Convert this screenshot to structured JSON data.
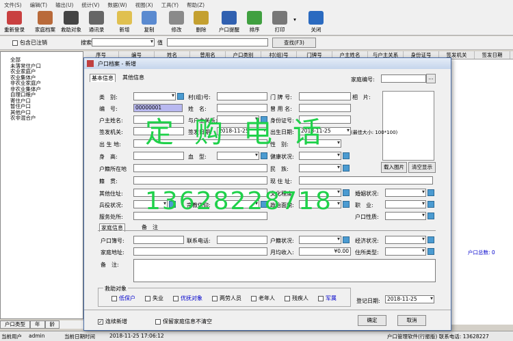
{
  "menu": [
    "文件(S)",
    "编辑(T)",
    "输出(U)",
    "统计(V)",
    "数据(W)",
    "视图(X)",
    "工具(Y)",
    "帮助(Z)"
  ],
  "toolbar": [
    "重新登录",
    "家庭档案",
    "救助对象",
    "通讯录",
    "新增",
    "复制",
    "修改",
    "删除",
    "户口提醒",
    "排序",
    "打印",
    "关闭"
  ],
  "filter": {
    "include_cancelled": "包含已注销",
    "search_label": "搜索",
    "value_label": "值",
    "find_button": "查找(F3)"
  },
  "tree": [
    "全部",
    "未落常住户口",
    "农业家庭户",
    "农业集体户",
    "非农业家庭户",
    "非农业集体户",
    "自理口粮户",
    "寄住户口",
    "暂住户口",
    "其他户口",
    "农非混合户"
  ],
  "grid_columns": [
    "序号",
    "户口类别",
    "村(组)号",
    "门牌号",
    "户主姓名",
    "与户主关系",
    "身份证号",
    "签发机关",
    "签发日期"
  ],
  "grid_columns_top": [
    "序号",
    "编号",
    "姓名",
    "曾用名",
    "户口类别",
    "村(组)号",
    "门牌号",
    "户主姓名",
    "与户主关系",
    "身份证号",
    "签发机关",
    "签发日期"
  ],
  "grid_total_label": "户口总数: 0",
  "bottom_tabs": [
    "户口类型",
    "年",
    "龄"
  ],
  "status": {
    "user_label": "当前用户",
    "user": "admin",
    "date_label": "当前日期时间",
    "datetime": "2018-11-25 17:06:12",
    "right": "户口管理软件(行振版) 联系电话: 13628227"
  },
  "dialog": {
    "title": "户口档案 - 新增",
    "tabs": [
      "基本信息",
      "其他信息"
    ],
    "family_no_label": "家庭编号:",
    "labels": {
      "category": "类　别:",
      "village": "村(组)号:",
      "door": "门 牌 号:",
      "photo": "相　片:",
      "serial": "编　号:",
      "name": "姓　名:",
      "former_name": "曾 用 名:",
      "householder": "户主姓名:",
      "relation": "与户主关系:",
      "id_no": "身份证号:",
      "issuer": "签发机关:",
      "issue_date": "签发日期:",
      "birth_date": "出生日期:",
      "birthplace": "出 生 地:",
      "gender": "性　别:",
      "height": "身　高:",
      "blood": "血　型:",
      "health": "健康状况:",
      "registry": "户籍所在地",
      "ethnic": "民　族:",
      "native": "籍　贯:",
      "current_addr": "现 住 址:",
      "other_addr": "其他住址:",
      "education": "文化程度:",
      "marriage": "婚姻状况:",
      "military": "兵役状况:",
      "religion": "宗教信仰:",
      "politics": "政治面貌:",
      "job": "职　业:",
      "workplace": "服务处所:",
      "hukou_nature": "户口性质:"
    },
    "serial_value": "00000001",
    "issue_date_value": "2018-11-25",
    "birth_date_value": "2018-11-25",
    "photo_size_note": "(最佳大小: 100*100)",
    "photo_load": "载入图片",
    "photo_clear": "清空显示",
    "sub_tabs": [
      "家庭信息",
      "备　注"
    ],
    "family": {
      "book_no": "户口簿号:",
      "phone": "联系电话:",
      "hukou_status": "户籍状况:",
      "economy": "经济状况:",
      "address": "家庭地址:",
      "income": "月均收入:",
      "income_value": "¥0.00",
      "housing": "住所类型:",
      "remark": "备　注:"
    },
    "aid": {
      "label": "救助对象",
      "items": [
        {
          "text": "低保户",
          "color": "#0000cc"
        },
        {
          "text": "失业",
          "color": "#000000"
        },
        {
          "text": "优抚对象",
          "color": "#0000cc"
        },
        {
          "text": "两劳人员",
          "color": "#000000"
        },
        {
          "text": "老年人",
          "color": "#000000"
        },
        {
          "text": "残疾人",
          "color": "#000000"
        },
        {
          "text": "军属",
          "color": "#0000cc"
        }
      ]
    },
    "register_date_label": "登记日期:",
    "register_date_value": "2018-11-25",
    "continue_add": "连续新增",
    "keep_family": "保留家庭信息不清空",
    "ok": "确定",
    "cancel": "取消"
  },
  "watermark": {
    "text": "定购电话",
    "phone": "13628228718"
  }
}
